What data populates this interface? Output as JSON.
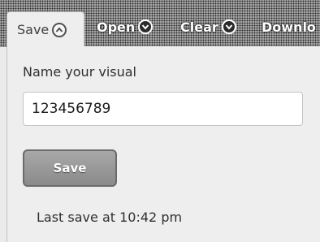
{
  "toolbar": {
    "tabs": [
      {
        "label": "Save",
        "icon": "chevron-up-icon"
      },
      {
        "label": "Open",
        "icon": "chevron-down-icon"
      },
      {
        "label": "Clear",
        "icon": "chevron-down-icon"
      },
      {
        "label": "Downlo"
      }
    ]
  },
  "panel": {
    "name_label": "Name your visual",
    "name_value": "123456789",
    "save_button": "Save",
    "last_save": "Last save at 10:42 pm"
  }
}
